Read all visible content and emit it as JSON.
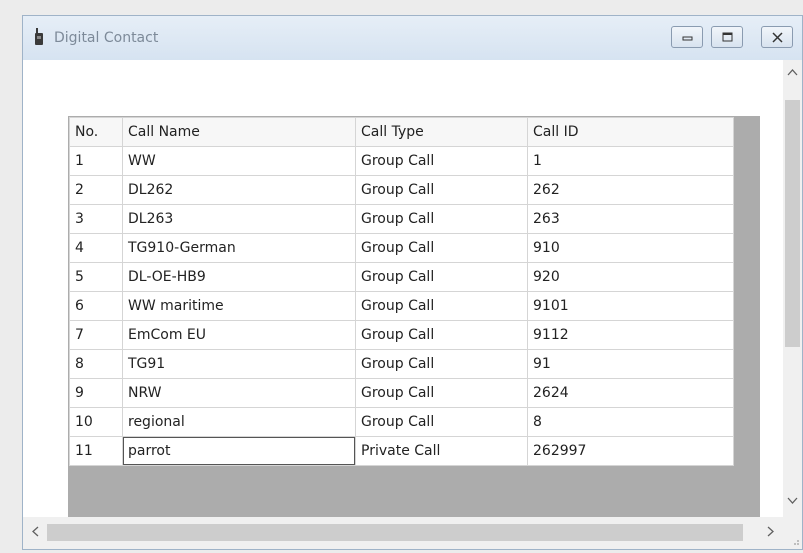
{
  "window": {
    "title": "Digital Contact"
  },
  "table": {
    "headers": {
      "no": "No.",
      "name": "Call Name",
      "type": "Call Type",
      "id": "Call ID"
    },
    "rows": [
      {
        "no": "1",
        "name": "WW",
        "type": "Group Call",
        "id": "1"
      },
      {
        "no": "2",
        "name": "DL262",
        "type": "Group Call",
        "id": "262"
      },
      {
        "no": "3",
        "name": "DL263",
        "type": "Group Call",
        "id": "263"
      },
      {
        "no": "4",
        "name": "TG910-German",
        "type": "Group Call",
        "id": "910"
      },
      {
        "no": "5",
        "name": "DL-OE-HB9",
        "type": "Group Call",
        "id": "920"
      },
      {
        "no": "6",
        "name": "WW maritime",
        "type": "Group Call",
        "id": "9101"
      },
      {
        "no": "7",
        "name": "EmCom EU",
        "type": "Group Call",
        "id": "9112"
      },
      {
        "no": "8",
        "name": "TG91",
        "type": "Group Call",
        "id": "91"
      },
      {
        "no": "9",
        "name": "NRW",
        "type": "Group Call",
        "id": "2624"
      },
      {
        "no": "10",
        "name": "regional",
        "type": "Group Call",
        "id": "8"
      },
      {
        "no": "11",
        "name": "parrot",
        "type": "Private Call",
        "id": "262997"
      }
    ]
  },
  "icons": {
    "app": "radio-icon",
    "minimize": "minimize-icon",
    "maximize": "maximize-icon",
    "close": "close-icon",
    "scroll_up": "chevron-up-icon",
    "scroll_down": "chevron-down-icon",
    "scroll_left": "chevron-left-icon",
    "scroll_right": "chevron-right-icon"
  },
  "colors": {
    "titlebar": "#dde8f4",
    "grid_background": "#acacac",
    "title_text": "#7d8a99"
  }
}
